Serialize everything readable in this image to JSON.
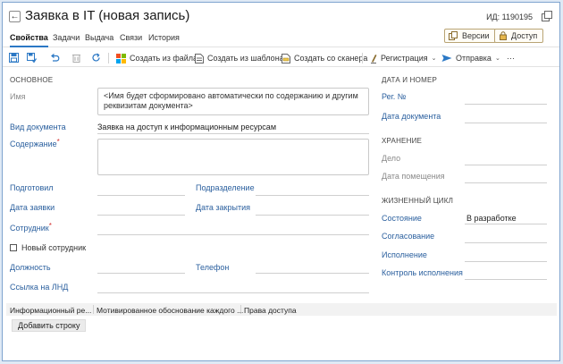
{
  "header": {
    "title": "Заявка в IT (новая запись)",
    "id_text": "ИД: 1190195",
    "versions_label": "Версии",
    "access_label": "Доступ"
  },
  "tabs": [
    {
      "label": "Свойства",
      "active": true
    },
    {
      "label": "Задачи",
      "active": false
    },
    {
      "label": "Выдача",
      "active": false
    },
    {
      "label": "Связи",
      "active": false
    },
    {
      "label": "История",
      "active": false
    }
  ],
  "toolbar": {
    "create_from_file": "Создать из файла",
    "create_from_template": "Создать из шаблона",
    "create_from_scanner": "Создать со сканера",
    "registration": "Регистрация",
    "sending": "Отправка",
    "more": "···"
  },
  "sections": {
    "main": "ОСНОВНОЕ",
    "date_number": "ДАТА И НОМЕР",
    "storage": "ХРАНЕНИЕ",
    "lifecycle": "ЖИЗНЕННЫЙ ЦИКЛ"
  },
  "fields": {
    "name_label": "Имя",
    "name_value": "<Имя будет сформировано автоматически по содержанию и другим реквизитам документа>",
    "doc_type_label": "Вид документа",
    "doc_type_value": "Заявка на доступ к информационным ресурсам",
    "content_label": "Содержание",
    "required_mark": "*",
    "prepared_label": "Подготовил",
    "department_label": "Подразделение",
    "request_date_label": "Дата заявки",
    "close_date_label": "Дата закрытия",
    "employee_label": "Сотрудник",
    "new_employee_label": "Новый сотрудник",
    "position_label": "Должность",
    "phone_label": "Телефон",
    "lnd_link_label": "Ссылка на ЛНД",
    "reg_number_label": "Рег. №",
    "doc_date_label": "Дата документа",
    "case_label": "Дело",
    "placement_date_label": "Дата помещения",
    "state_label": "Состояние",
    "state_value": "В разработке",
    "approval_label": "Согласование",
    "execution_label": "Исполнение",
    "execution_control_label": "Контроль исполнения"
  },
  "table": {
    "columns": [
      "Информационный ре...",
      "Мотивированное обоснование каждого ...",
      "Права доступа"
    ],
    "add_row_label": "Добавить строку"
  },
  "colors": {
    "accent": "#2b78c5",
    "label_blue": "#2a5f9e",
    "required": "#d32f2f",
    "window_border": "#7fa4cf"
  }
}
